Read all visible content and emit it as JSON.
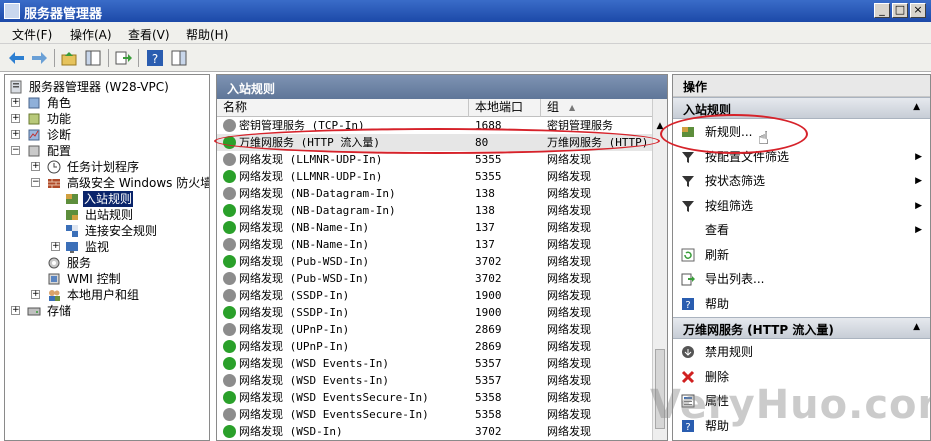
{
  "window": {
    "title": "服务器管理器",
    "controls": [
      "_",
      "□",
      "×"
    ]
  },
  "menu": [
    "文件(F)",
    "操作(A)",
    "查看(V)",
    "帮助(H)"
  ],
  "tree": {
    "root": "服务器管理器 (W28-VPC)",
    "items": [
      {
        "label": "角色",
        "level": 1
      },
      {
        "label": "功能",
        "level": 1
      },
      {
        "label": "诊断",
        "level": 1
      },
      {
        "label": "配置",
        "level": 1
      },
      {
        "label": "任务计划程序",
        "level": 2
      },
      {
        "label": "高级安全 Windows 防火墙",
        "level": 2
      },
      {
        "label": "入站规则",
        "level": 3,
        "selected": true
      },
      {
        "label": "出站规则",
        "level": 3
      },
      {
        "label": "连接安全规则",
        "level": 3
      },
      {
        "label": "监视",
        "level": 3
      },
      {
        "label": "服务",
        "level": 2
      },
      {
        "label": "WMI 控制",
        "level": 2
      },
      {
        "label": "本地用户和组",
        "level": 2
      },
      {
        "label": "存储",
        "level": 1
      }
    ]
  },
  "center": {
    "header": "入站规则",
    "columns": [
      "名称",
      "本地端口",
      "组"
    ],
    "sort_indicator": "▲",
    "rows": [
      {
        "name": "密钥管理服务 (TCP-In)",
        "port": "1688",
        "group": "密钥管理服务",
        "enabled": false
      },
      {
        "name": "万维网服务 (HTTP 流入量)",
        "port": "80",
        "group": "万维网服务 (HTTP)",
        "enabled": true
      },
      {
        "name": "网络发现 (LLMNR-UDP-In)",
        "port": "5355",
        "group": "网络发现",
        "enabled": false
      },
      {
        "name": "网络发现 (LLMNR-UDP-In)",
        "port": "5355",
        "group": "网络发现",
        "enabled": true
      },
      {
        "name": "网络发现 (NB-Datagram-In)",
        "port": "138",
        "group": "网络发现",
        "enabled": false
      },
      {
        "name": "网络发现 (NB-Datagram-In)",
        "port": "138",
        "group": "网络发现",
        "enabled": true
      },
      {
        "name": "网络发现 (NB-Name-In)",
        "port": "137",
        "group": "网络发现",
        "enabled": true
      },
      {
        "name": "网络发现 (NB-Name-In)",
        "port": "137",
        "group": "网络发现",
        "enabled": false
      },
      {
        "name": "网络发现 (Pub-WSD-In)",
        "port": "3702",
        "group": "网络发现",
        "enabled": true
      },
      {
        "name": "网络发现 (Pub-WSD-In)",
        "port": "3702",
        "group": "网络发现",
        "enabled": false
      },
      {
        "name": "网络发现 (SSDP-In)",
        "port": "1900",
        "group": "网络发现",
        "enabled": false
      },
      {
        "name": "网络发现 (SSDP-In)",
        "port": "1900",
        "group": "网络发现",
        "enabled": true
      },
      {
        "name": "网络发现 (UPnP-In)",
        "port": "2869",
        "group": "网络发现",
        "enabled": false
      },
      {
        "name": "网络发现 (UPnP-In)",
        "port": "2869",
        "group": "网络发现",
        "enabled": true
      },
      {
        "name": "网络发现 (WSD Events-In)",
        "port": "5357",
        "group": "网络发现",
        "enabled": true
      },
      {
        "name": "网络发现 (WSD Events-In)",
        "port": "5357",
        "group": "网络发现",
        "enabled": false
      },
      {
        "name": "网络发现 (WSD EventsSecure-In)",
        "port": "5358",
        "group": "网络发现",
        "enabled": true
      },
      {
        "name": "网络发现 (WSD EventsSecure-In)",
        "port": "5358",
        "group": "网络发现",
        "enabled": false
      },
      {
        "name": "网络发现 (WSD-In)",
        "port": "3702",
        "group": "网络发现",
        "enabled": true
      }
    ]
  },
  "actions": {
    "title": "操作",
    "section1": "入站规则",
    "section1_items": [
      {
        "label": "新规则...",
        "icon": "new-rule-icon",
        "submenu": false
      },
      {
        "label": "按配置文件筛选",
        "icon": "filter-icon",
        "submenu": true
      },
      {
        "label": "按状态筛选",
        "icon": "filter-icon",
        "submenu": true
      },
      {
        "label": "按组筛选",
        "icon": "filter-icon",
        "submenu": true
      },
      {
        "label": "查看",
        "icon": "",
        "submenu": true
      },
      {
        "label": "刷新",
        "icon": "refresh-icon",
        "submenu": false
      },
      {
        "label": "导出列表...",
        "icon": "export-icon",
        "submenu": false
      },
      {
        "label": "帮助",
        "icon": "help-icon",
        "submenu": false
      }
    ],
    "section2": "万维网服务 (HTTP 流入量)",
    "section2_items": [
      {
        "label": "禁用规则",
        "icon": "disable-icon"
      },
      {
        "label": "删除",
        "icon": "delete-icon"
      },
      {
        "label": "属性",
        "icon": "properties-icon"
      },
      {
        "label": "帮助",
        "icon": "help-icon"
      }
    ]
  },
  "watermark": "VeryHuo.com",
  "colors": {
    "enabled": "#2aa02a",
    "disabled": "#8c8c8c",
    "oval": "#d6222a"
  }
}
